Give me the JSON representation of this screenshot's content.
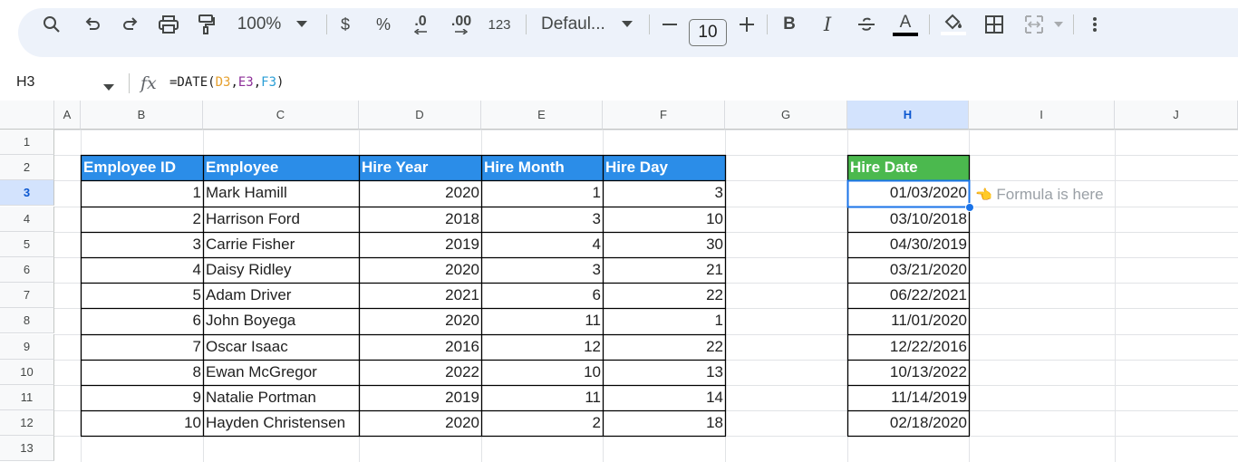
{
  "toolbar": {
    "zoom": "100%",
    "currency": "$",
    "percent": "%",
    "dec_decrease": ".0",
    "dec_increase": ".00",
    "more_formats": "123",
    "font": "Defaul...",
    "font_size": "10",
    "bold": "B",
    "italic": "I",
    "text_color_glyph": "A",
    "icons": [
      "search-icon",
      "undo-icon",
      "redo-icon",
      "print-icon",
      "paint-format-icon",
      "zoom-dropdown-icon",
      "font-dropdown-icon",
      "minus-icon",
      "plus-icon",
      "strikethrough-icon",
      "fill-color-icon",
      "borders-icon",
      "merge-cells-icon",
      "more-vert-icon"
    ]
  },
  "formula_bar": {
    "name_box": "H3",
    "fx": "fx",
    "formula_prefix": "=DATE(",
    "ref1": "D3",
    "comma1": ",",
    "ref2": "E3",
    "comma2": ",",
    "ref3": "F3",
    "formula_suffix": ")"
  },
  "columns": [
    "A",
    "B",
    "C",
    "D",
    "E",
    "F",
    "G",
    "H",
    "I",
    "J"
  ],
  "rows": [
    "1",
    "2",
    "3",
    "4",
    "5",
    "6",
    "7",
    "8",
    "9",
    "10",
    "11",
    "12",
    "13"
  ],
  "table": {
    "headers": [
      "Employee ID",
      "Employee",
      "Hire Year",
      "Hire Month",
      "Hire Day"
    ],
    "rows": [
      [
        "1",
        "Mark Hamill",
        "2020",
        "1",
        "3"
      ],
      [
        "2",
        "Harrison Ford",
        "2018",
        "3",
        "10"
      ],
      [
        "3",
        "Carrie Fisher",
        "2019",
        "4",
        "30"
      ],
      [
        "4",
        "Daisy Ridley",
        "2020",
        "3",
        "21"
      ],
      [
        "5",
        "Adam Driver",
        "2021",
        "6",
        "22"
      ],
      [
        "6",
        "John Boyega",
        "2020",
        "11",
        "1"
      ],
      [
        "7",
        "Oscar Isaac",
        "2016",
        "12",
        "22"
      ],
      [
        "8",
        "Ewan McGregor",
        "2022",
        "10",
        "13"
      ],
      [
        "9",
        "Natalie Portman",
        "2019",
        "11",
        "14"
      ],
      [
        "10",
        "Hayden Christensen",
        "2020",
        "2",
        "18"
      ]
    ]
  },
  "hire_date": {
    "header": "Hire Date",
    "values": [
      "01/03/2020",
      "03/10/2018",
      "04/30/2019",
      "03/21/2020",
      "06/22/2021",
      "11/01/2020",
      "12/22/2016",
      "10/13/2022",
      "11/14/2019",
      "02/18/2020"
    ]
  },
  "note": {
    "hand": "👈",
    "text": "Formula is here"
  },
  "colors": {
    "header_blue": "#2b8de8",
    "header_green": "#4bb94e",
    "selection": "#1a73e8"
  }
}
